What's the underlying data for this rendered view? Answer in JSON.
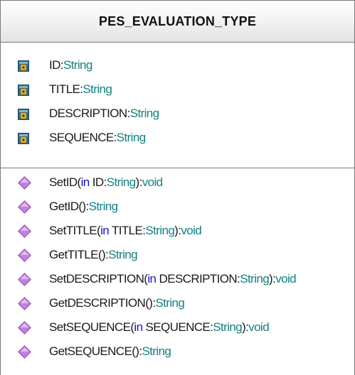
{
  "class": {
    "name": "PES_EVALUATION_TYPE",
    "attributes": [
      {
        "name": "ID",
        "sep": ":",
        "type": "String",
        "icon": "protected-attribute-icon"
      },
      {
        "name": "TITLE",
        "sep": ":",
        "type": "String",
        "icon": "protected-attribute-icon"
      },
      {
        "name": "DESCRIPTION",
        "sep": ":",
        "type": "String",
        "icon": "protected-attribute-icon"
      },
      {
        "name": "SEQUENCE",
        "sep": ":",
        "type": "String",
        "icon": "protected-attribute-icon"
      }
    ],
    "operations": [
      {
        "name": "SetID",
        "open": "(",
        "kw": "in",
        "param": " ID",
        "psep": ":",
        "ptype": "String",
        "close": "):",
        "ret": "void"
      },
      {
        "name": "GetID",
        "open": "()",
        "kw": "",
        "param": "",
        "psep": "",
        "ptype": "",
        "close": ":",
        "ret": "String"
      },
      {
        "name": "SetTITLE",
        "open": "(",
        "kw": "in",
        "param": " TITLE",
        "psep": ":",
        "ptype": "String",
        "close": "):",
        "ret": "void"
      },
      {
        "name": "GetTITLE",
        "open": "()",
        "kw": "",
        "param": "",
        "psep": "",
        "ptype": "",
        "close": ":",
        "ret": "String"
      },
      {
        "name": "SetDESCRIPTION",
        "open": "(",
        "kw": "in",
        "param": " DESCRIPTION",
        "psep": ":",
        "ptype": "String",
        "close": "):",
        "ret": "void"
      },
      {
        "name": "GetDESCRIPTION",
        "open": "()",
        "kw": "",
        "param": "",
        "psep": "",
        "ptype": "",
        "close": ":",
        "ret": "String"
      },
      {
        "name": "SetSEQUENCE",
        "open": "(",
        "kw": "in",
        "param": " SEQUENCE",
        "psep": ":",
        "ptype": "String",
        "close": "):",
        "ret": "void"
      },
      {
        "name": "GetSEQUENCE",
        "open": "()",
        "kw": "",
        "param": "",
        "psep": "",
        "ptype": "",
        "close": ":",
        "ret": "String"
      }
    ]
  },
  "colors": {
    "name_text": "#1a1a1a",
    "type_text": "#138080",
    "keyword_text": "#1414c8",
    "operation_icon": "#c77ee0",
    "attribute_icon": "#2f6a8a",
    "lock_icon": "#d4a020"
  }
}
